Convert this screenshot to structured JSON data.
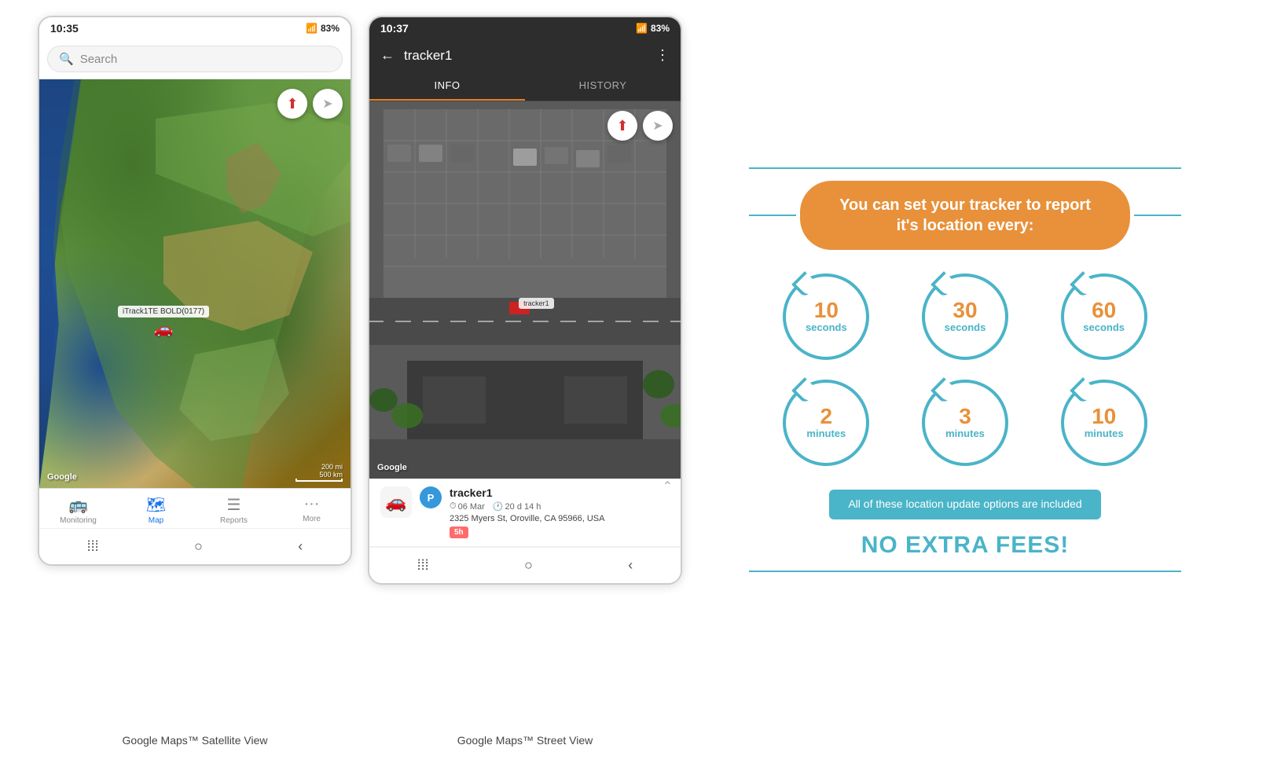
{
  "page": {
    "background": "#ffffff"
  },
  "phone1": {
    "status": {
      "time": "10:35",
      "signal": "📶",
      "battery": "83%"
    },
    "search": {
      "placeholder": "Search"
    },
    "map": {
      "tracker_label": "iTrack1TE BOLD(0177)",
      "google_watermark": "Google",
      "scale_200mi": "200 mi",
      "scale_500km": "500 km"
    },
    "nav": {
      "items": [
        {
          "label": "Monitoring",
          "icon": "🚌",
          "active": false
        },
        {
          "label": "Map",
          "icon": "🗺",
          "active": true
        },
        {
          "label": "Reports",
          "icon": "☰",
          "active": false
        },
        {
          "label": "More",
          "icon": "···",
          "active": false
        }
      ]
    },
    "caption": "Google Maps™ Satellite View"
  },
  "phone2": {
    "status": {
      "time": "10:37",
      "signal": "📶",
      "battery": "83%"
    },
    "header": {
      "title": "tracker1",
      "back_label": "←",
      "more_label": "⋮"
    },
    "tabs": [
      {
        "label": "INFO",
        "active": true
      },
      {
        "label": "HISTORY",
        "active": false
      }
    ],
    "map": {
      "tracker_label": "tracker1",
      "google_watermark": "Google"
    },
    "tracker_info": {
      "name": "tracker1",
      "date": "06 Mar",
      "duration": "20 d 14 h",
      "address": "2325 Myers St, Oroville, CA 95966, USA",
      "badge": "5h"
    },
    "caption": "Google Maps™ Street View"
  },
  "info_graphic": {
    "headline": "You can set your tracker to report it's location every:",
    "intervals": [
      {
        "number": "10",
        "unit": "seconds"
      },
      {
        "number": "30",
        "unit": "seconds"
      },
      {
        "number": "60",
        "unit": "seconds"
      },
      {
        "number": "2",
        "unit": "minutes"
      },
      {
        "number": "3",
        "unit": "minutes"
      },
      {
        "number": "10",
        "unit": "minutes"
      }
    ],
    "included_text": "All of these location update options are included",
    "no_fees": "NO EXTRA FEES!"
  }
}
